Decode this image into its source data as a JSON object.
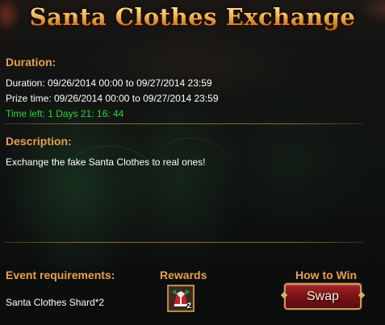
{
  "title": "Santa Clothes Exchange",
  "duration": {
    "heading": "Duration:",
    "duration_line": "Duration: 09/26/2014 00:00 to 09/27/2014 23:59",
    "prize_line": "Prize time: 09/26/2014 00:00 to 09/27/2014 23:59",
    "time_left": "Time left: 1 Days  21: 16: 44"
  },
  "description": {
    "heading": "Description:",
    "text": "Exchange the fake Santa Clothes to real ones!"
  },
  "requirements": {
    "heading": "Event requirements:",
    "item": "Santa Clothes Shard*2"
  },
  "rewards": {
    "heading": "Rewards",
    "item_icon": "santa-clothes-icon",
    "item_count": "2"
  },
  "how_to_win": {
    "heading": "How to Win",
    "button_label": "Swap"
  },
  "colors": {
    "heading": "#e8a04c",
    "title_gold": "#f3b757",
    "time_left_green": "#2fd23c",
    "button_red": "#7a1216"
  }
}
